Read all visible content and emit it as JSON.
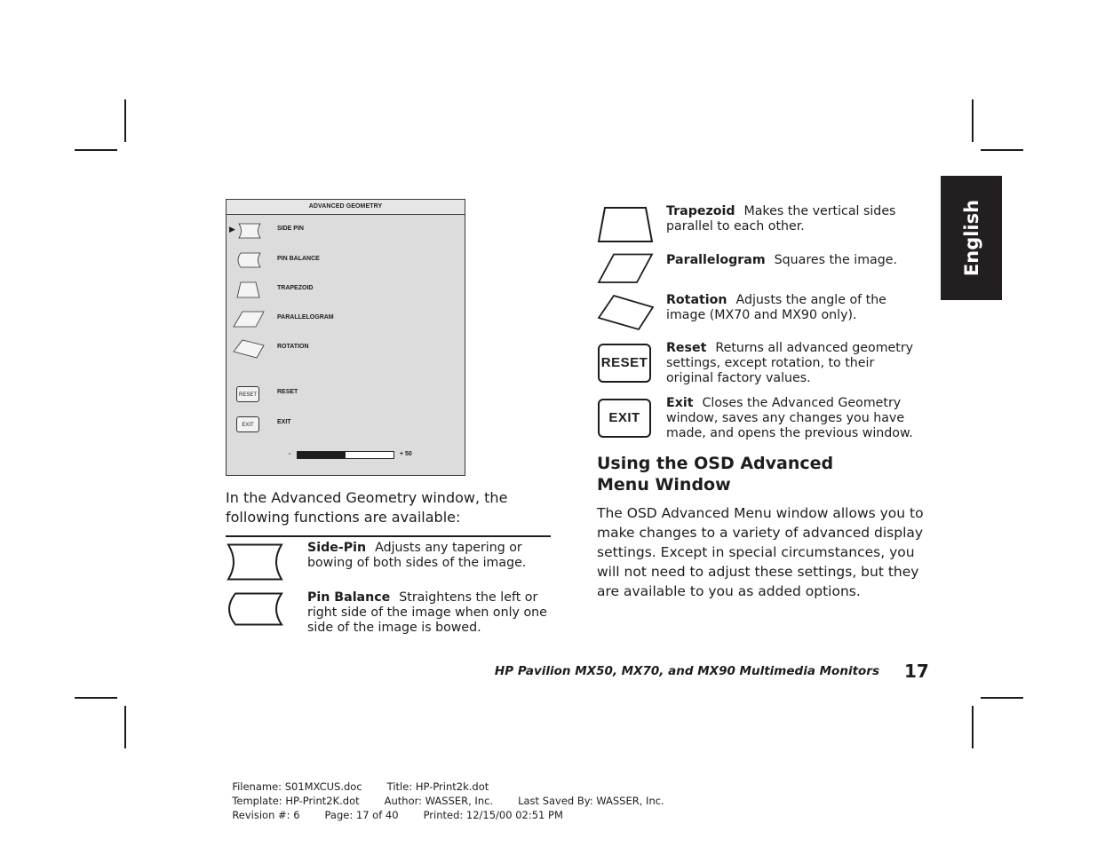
{
  "osd_window": {
    "title": "ADVANCED GEOMETRY",
    "selected_indicator": "▶",
    "items": [
      {
        "label": "SIDE PIN",
        "icon": "side-pin-icon"
      },
      {
        "label": "PIN BALANCE",
        "icon": "pin-balance-icon"
      },
      {
        "label": "TRAPEZOID",
        "icon": "trapezoid-icon"
      },
      {
        "label": "PARALLELOGRAM",
        "icon": "parallelogram-icon"
      },
      {
        "label": "ROTATION",
        "icon": "rotation-icon"
      },
      {
        "label": "RESET",
        "icon": "reset-button-icon",
        "icon_text": "RESET"
      },
      {
        "label": "EXIT",
        "icon": "exit-button-icon",
        "icon_text": "EXIT"
      }
    ],
    "slider": {
      "min_label": "-",
      "max_label": "+ 50",
      "fill_fraction": 0.5
    }
  },
  "intro": "In the Advanced Geometry window, the following functions are available:",
  "features_left": [
    {
      "name": "Side-Pin",
      "desc": "Adjusts any tapering or bowing of both sides of the image.",
      "icon": "side-pin-icon"
    },
    {
      "name": "Pin Balance",
      "desc": "Straightens the left or right side of the image when only one side of the image is bowed.",
      "icon": "pin-balance-icon"
    }
  ],
  "features_right": [
    {
      "name": "Trapezoid",
      "desc": "Makes the vertical sides parallel to each other.",
      "icon": "trapezoid-icon"
    },
    {
      "name": "Parallelogram",
      "desc": "Squares the image.",
      "icon": "parallelogram-icon"
    },
    {
      "name": "Rotation",
      "desc": "Adjusts the angle of the image (MX70 and MX90 only).",
      "icon": "rotation-icon"
    },
    {
      "name": "Reset",
      "desc": "Returns all advanced geometry settings, except rotation, to their original factory values.",
      "icon": "reset-button-icon",
      "icon_text": "RESET"
    },
    {
      "name": "Exit",
      "desc": "Closes the Advanced Geometry window, saves any changes you have made, and opens the previous window.",
      "icon": "exit-button-icon",
      "icon_text": "EXIT"
    }
  ],
  "section": {
    "heading_line1": "Using the OSD Advanced",
    "heading_line2": "Menu Window",
    "body": "The OSD Advanced Menu window allows you to make changes to a variety of advanced display settings. Except in special circumstances, you will not need to adjust these settings, but they are available to you as added options."
  },
  "language_tab": "English",
  "footer": {
    "running_title": "HP Pavilion MX50, MX70, and MX90 Multimedia Monitors",
    "page_number": "17"
  },
  "doc_meta": {
    "line1": [
      "Filename: S01MXCUS.doc",
      "Title: HP-Print2k.dot"
    ],
    "line2": [
      "Template: HP-Print2K.dot",
      "Author: WASSER, Inc.",
      "Last Saved By: WASSER, Inc."
    ],
    "line3": [
      "Revision #: 6",
      "Page: 17 of 40",
      "Printed: 12/15/00 02:51 PM"
    ]
  },
  "colors": {
    "ink": "#1f1c1c",
    "osd_bg": "#dcdcdc",
    "tab_bg": "#231f20"
  }
}
